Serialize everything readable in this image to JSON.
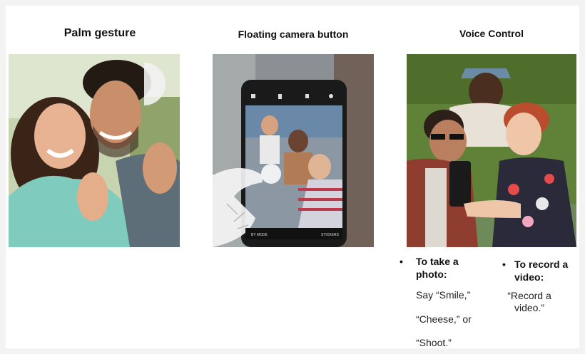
{
  "headings": {
    "palm": "Palm gesture",
    "floating": "Floating camera button",
    "voice": "Voice Control"
  },
  "phone_ui": {
    "left_mode": "BY MODE",
    "right_mode": "STICKERS"
  },
  "voice": {
    "photo_bullet": "To take a photo:",
    "video_bullet": "To record a video:",
    "photo_say_1": "Say “Smile,”",
    "photo_say_2": "“Cheese,” or",
    "photo_say_3": "“Shoot.”",
    "video_say": "“Record a video.”",
    "bullet_symbol": "•"
  }
}
